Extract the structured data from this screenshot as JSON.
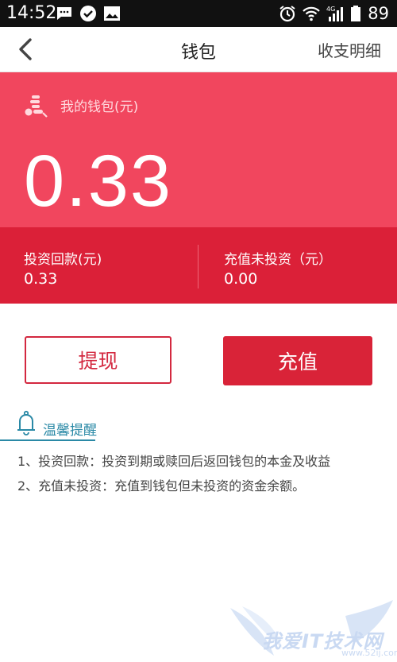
{
  "status_bar": {
    "time": "14:52",
    "network": "4G",
    "battery": "89"
  },
  "nav": {
    "title": "钱包",
    "right_action": "收支明细"
  },
  "wallet": {
    "label": "我的钱包(元)",
    "amount": "0.33",
    "investment_return_label": "投资回款(元)",
    "investment_return_value": "0.33",
    "uninvested_label": "充值未投资（元）",
    "uninvested_value": "0.00"
  },
  "actions": {
    "withdraw": "提现",
    "recharge": "充值"
  },
  "tips": {
    "title": "温馨提醒",
    "items": [
      "1、投资回款：投资到期或赎回后返回钱包的本金及收益",
      "2、充值未投资：充值到钱包但未投资的资金余额。"
    ]
  },
  "watermark": {
    "text": "我爱IT技术网",
    "url": "www.52ij.com"
  },
  "colors": {
    "card_red": "#f1465e",
    "panel_red": "#db2038",
    "button_red": "#d92338",
    "tips_accent": "#2a89a6"
  }
}
